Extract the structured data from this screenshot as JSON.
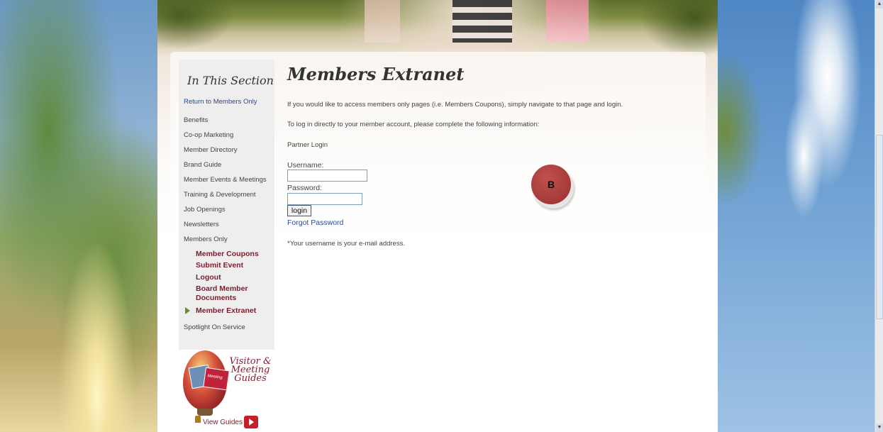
{
  "sidebar": {
    "title": "In This Section",
    "return_link": "Return to Members Only",
    "items": [
      "Benefits",
      "Co-op Marketing",
      "Member Directory",
      "Brand Guide",
      "Member Events & Meetings",
      "Training & Development",
      "Job Openings",
      "Newsletters",
      "Members Only"
    ],
    "sub_items": [
      "Member Coupons",
      "Submit Event",
      "Logout",
      "Board Member Documents",
      "Member Extranet"
    ],
    "after_item": "Spotlight On Service"
  },
  "promo": {
    "title": "Visitor & Meeting Guides",
    "card_text": "Meeting",
    "link": "View Guides"
  },
  "main": {
    "title": "Members Extranet",
    "intro": "If you would like to access members only pages (i.e. Members Coupons), simply navigate to that page and login.",
    "direct": "To log in directly to your member account, please complete the following information:",
    "section": "Partner Login",
    "username_label": "Username:",
    "password_label": "Password:",
    "username_value": "",
    "password_value": "",
    "login_button": "login",
    "forgot_link": "Forgot Password",
    "note": "*Your username is your e-mail address."
  },
  "marker": {
    "label": "B"
  },
  "colors": {
    "accent": "#7a1e2e",
    "link": "#2a4a9a",
    "marker": "#a43a38"
  }
}
